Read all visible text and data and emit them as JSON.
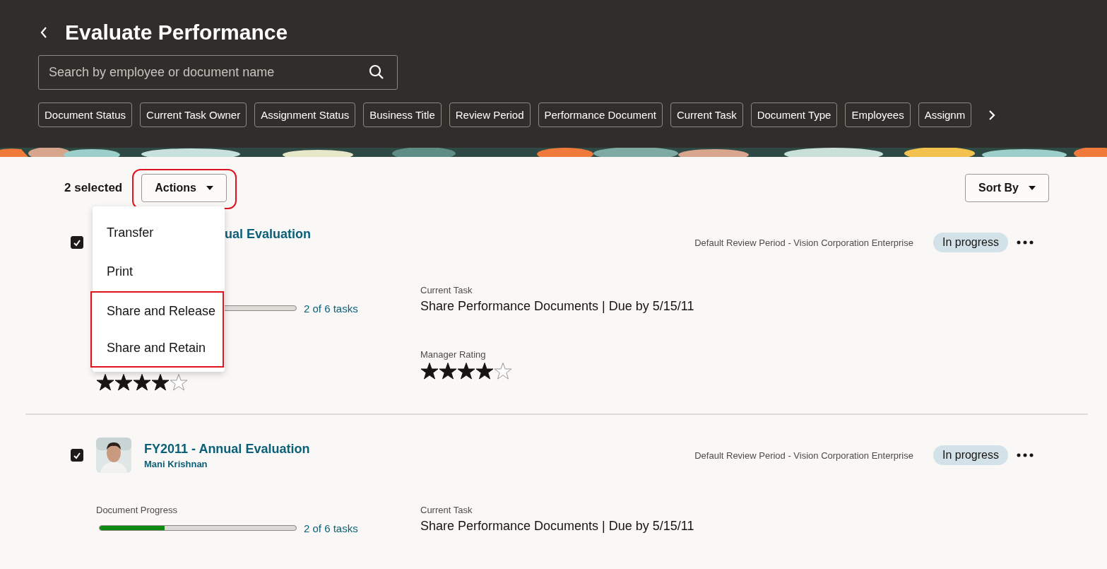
{
  "header": {
    "title": "Evaluate Performance",
    "search": {
      "placeholder": "Search by employee or document name"
    },
    "filters": [
      "Document Status",
      "Current Task Owner",
      "Assignment Status",
      "Business Title",
      "Review Period",
      "Performance Document",
      "Current Task",
      "Document Type",
      "Employees",
      "Assignm"
    ]
  },
  "toolbar": {
    "selection_count": "2 selected",
    "actions_button": {
      "label": "Actions",
      "highlighted": true
    },
    "sort_button": {
      "label": "Sort By"
    }
  },
  "actions_menu": {
    "expanded": true,
    "items": [
      {
        "label": "Transfer",
        "highlighted": false
      },
      {
        "label": "Print",
        "highlighted": false
      },
      {
        "label": "Share and Release",
        "highlighted": true
      },
      {
        "label": "Share and Retain",
        "highlighted": true
      }
    ]
  },
  "documents": [
    {
      "kind": "covered",
      "checked": true,
      "title": "ual Evaluation",
      "review_period": "Default Review Period - Vision Corporation Enterprise",
      "status": "In progress",
      "progress": {
        "reading": "2 of 6 tasks"
      },
      "current_task": {
        "label": "Current Task",
        "value": "Share Performance Documents | Due by 5/15/11"
      },
      "self_rating": {
        "stars": 4
      },
      "manager_rating": {
        "label": "Manager Rating",
        "stars": 4
      }
    },
    {
      "kind": "full",
      "checked": true,
      "title": "FY2011 - Annual Evaluation",
      "employee": "Mani Krishnan",
      "review_period": "Default Review Period - Vision Corporation Enterprise",
      "status": "In progress",
      "progress": {
        "label": "Document Progress",
        "level": 0.33,
        "reading": "2 of 6 tasks"
      },
      "current_task": {
        "label": "Current Task",
        "value": "Share Performance Documents | Due by 5/15/11"
      }
    }
  ]
}
